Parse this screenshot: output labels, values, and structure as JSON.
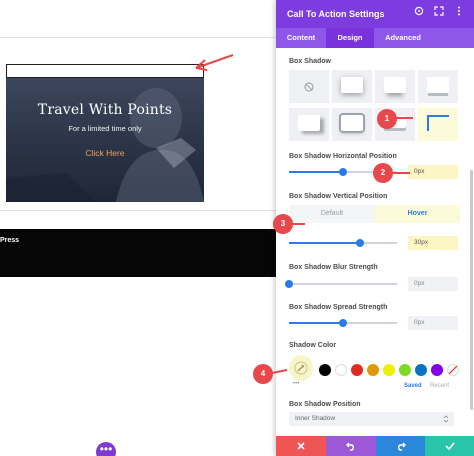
{
  "canvas": {
    "cta": {
      "title": "Travel With Points",
      "subtitle": "For a limited time only",
      "button": "Click Here"
    },
    "band_text": "Press",
    "fab_label": "•••"
  },
  "panel": {
    "title": "Call To Action Settings",
    "accent_color": "#7c3ce0",
    "header_icons": [
      "target-icon",
      "expand-icon",
      "more-icon"
    ],
    "tabs": [
      {
        "label": "Content",
        "active": false
      },
      {
        "label": "Design",
        "active": true
      },
      {
        "label": "Advanced",
        "active": false
      }
    ],
    "box_shadow": {
      "label": "Box Shadow",
      "selected_preset": 8
    },
    "horizontal": {
      "label": "Box Shadow Horizontal Position",
      "value": "0px"
    },
    "vertical": {
      "label": "Box Shadow Vertical Position",
      "default": "Default",
      "hover": "Hover",
      "value": "30px"
    },
    "blur": {
      "label": "Box Shadow Blur Strength",
      "value": "0px"
    },
    "spread": {
      "label": "Box Shadow Spread Strength",
      "value": "0px"
    },
    "shadow_color": {
      "label": "Shadow Color",
      "swatches": [
        "#000000",
        "#ffffff",
        "#e02b20",
        "#e09900",
        "#edf000",
        "#7cda24",
        "#0c71c3",
        "#8300e9"
      ],
      "saved": "Saved",
      "recent": "Recent",
      "more": "•••"
    },
    "position": {
      "label": "Box Shadow Position",
      "value": "Inner Shadow"
    },
    "bottom_bar": {
      "cancel_color": "#ef5555",
      "undo_color": "#9b59d8",
      "redo_color": "#2b87da",
      "save_color": "#29c4a9"
    }
  },
  "annotations": [
    "1",
    "2",
    "3",
    "4"
  ]
}
